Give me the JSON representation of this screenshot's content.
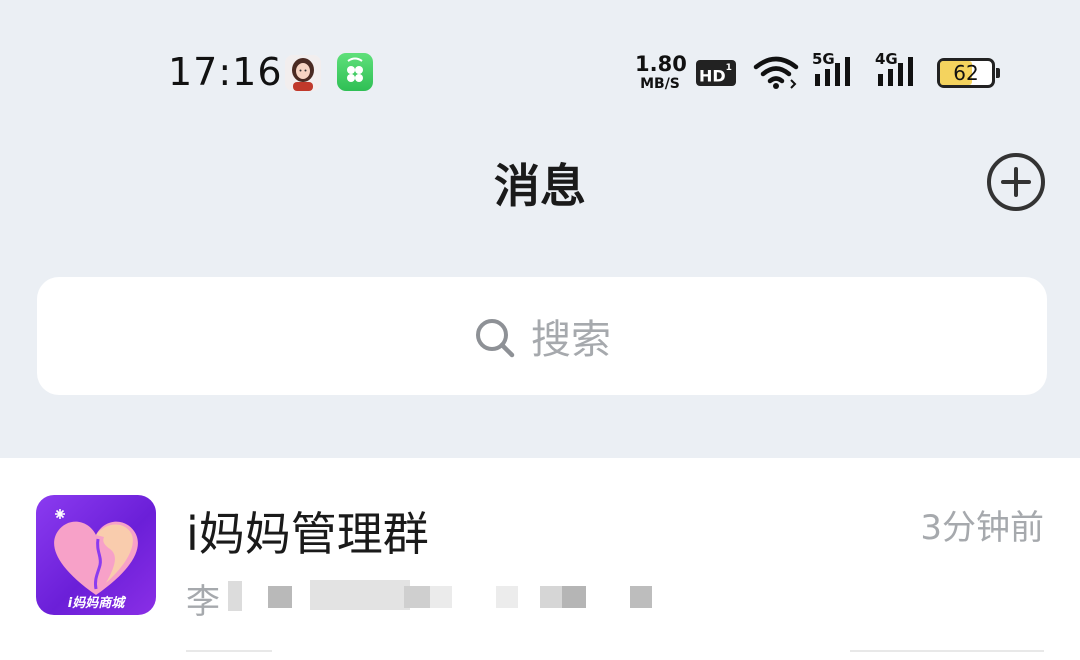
{
  "status_bar": {
    "time": "17:16",
    "net_speed_value": "1.80",
    "net_speed_unit": "MB/S",
    "hd_label": "HD",
    "hd_sub": "1",
    "signal1_label": "5G",
    "signal2_label": "4G",
    "battery_percent": "62",
    "battery_level": 0.62,
    "icons": [
      "avatar-notification-icon",
      "green-app-notification-icon",
      "wifi-icon",
      "signal-5g-icon",
      "signal-4g-icon",
      "battery-icon"
    ]
  },
  "header": {
    "title": "消息",
    "add_icon": "plus-circle-icon"
  },
  "search": {
    "placeholder": "搜索",
    "icon": "search-icon"
  },
  "chats": [
    {
      "name": "i妈妈管理群",
      "time": "3分钟前",
      "preview": "李 ",
      "avatar_text": "i妈妈商城",
      "avatar_colors": [
        "#8b3bf0",
        "#6b1fd8",
        "#f7a1c8"
      ]
    }
  ],
  "colors": {
    "background": "#ebeff4",
    "card": "#ffffff",
    "muted_text": "#a6a9ad",
    "battery_fill": "#f4d35e"
  }
}
